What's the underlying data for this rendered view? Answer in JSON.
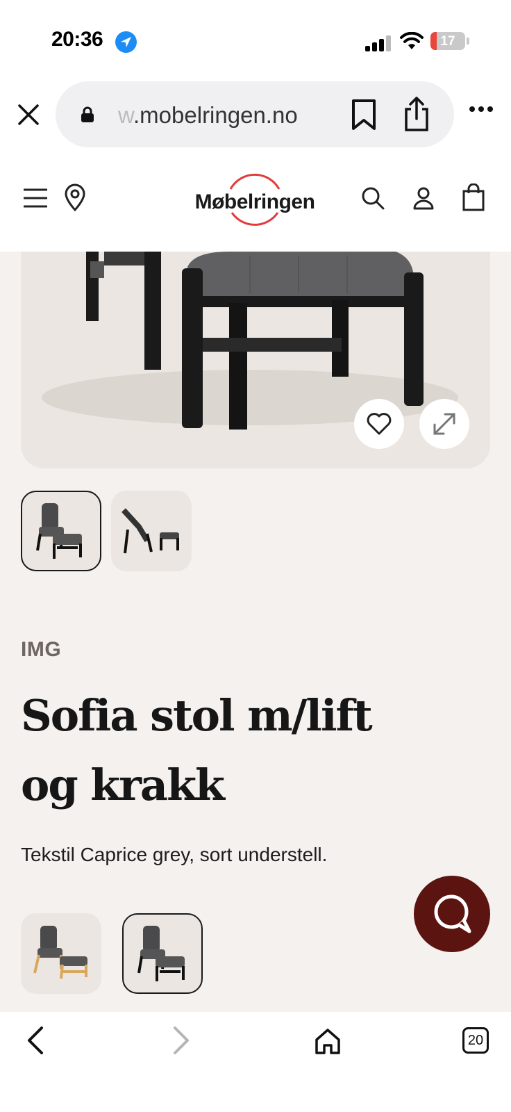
{
  "status_bar": {
    "time": "20:36",
    "battery": "17",
    "battery_fraction": 0.17
  },
  "browser": {
    "url_faded": "w",
    "url_main": ".mobelringen.no",
    "tab_count": "20"
  },
  "site": {
    "logo_text": "Møbelringen"
  },
  "product": {
    "brand": "IMG",
    "title": "Sofia stol m/lift og krakk",
    "description": "Tekstil Caprice grey, sort understell."
  },
  "colors": {
    "accent": "#e23b3b",
    "chat_button": "#5b1410",
    "background": "#f4f1ee"
  },
  "icons": [
    "close-icon",
    "lock-icon",
    "bookmark-icon",
    "share-icon",
    "more-icon",
    "menu-icon",
    "location-pin-icon",
    "search-icon",
    "user-icon",
    "shopping-bag-icon",
    "heart-icon",
    "expand-icon",
    "chat-icon",
    "back-arrow-icon",
    "forward-arrow-icon",
    "home-icon",
    "tabs-icon"
  ]
}
